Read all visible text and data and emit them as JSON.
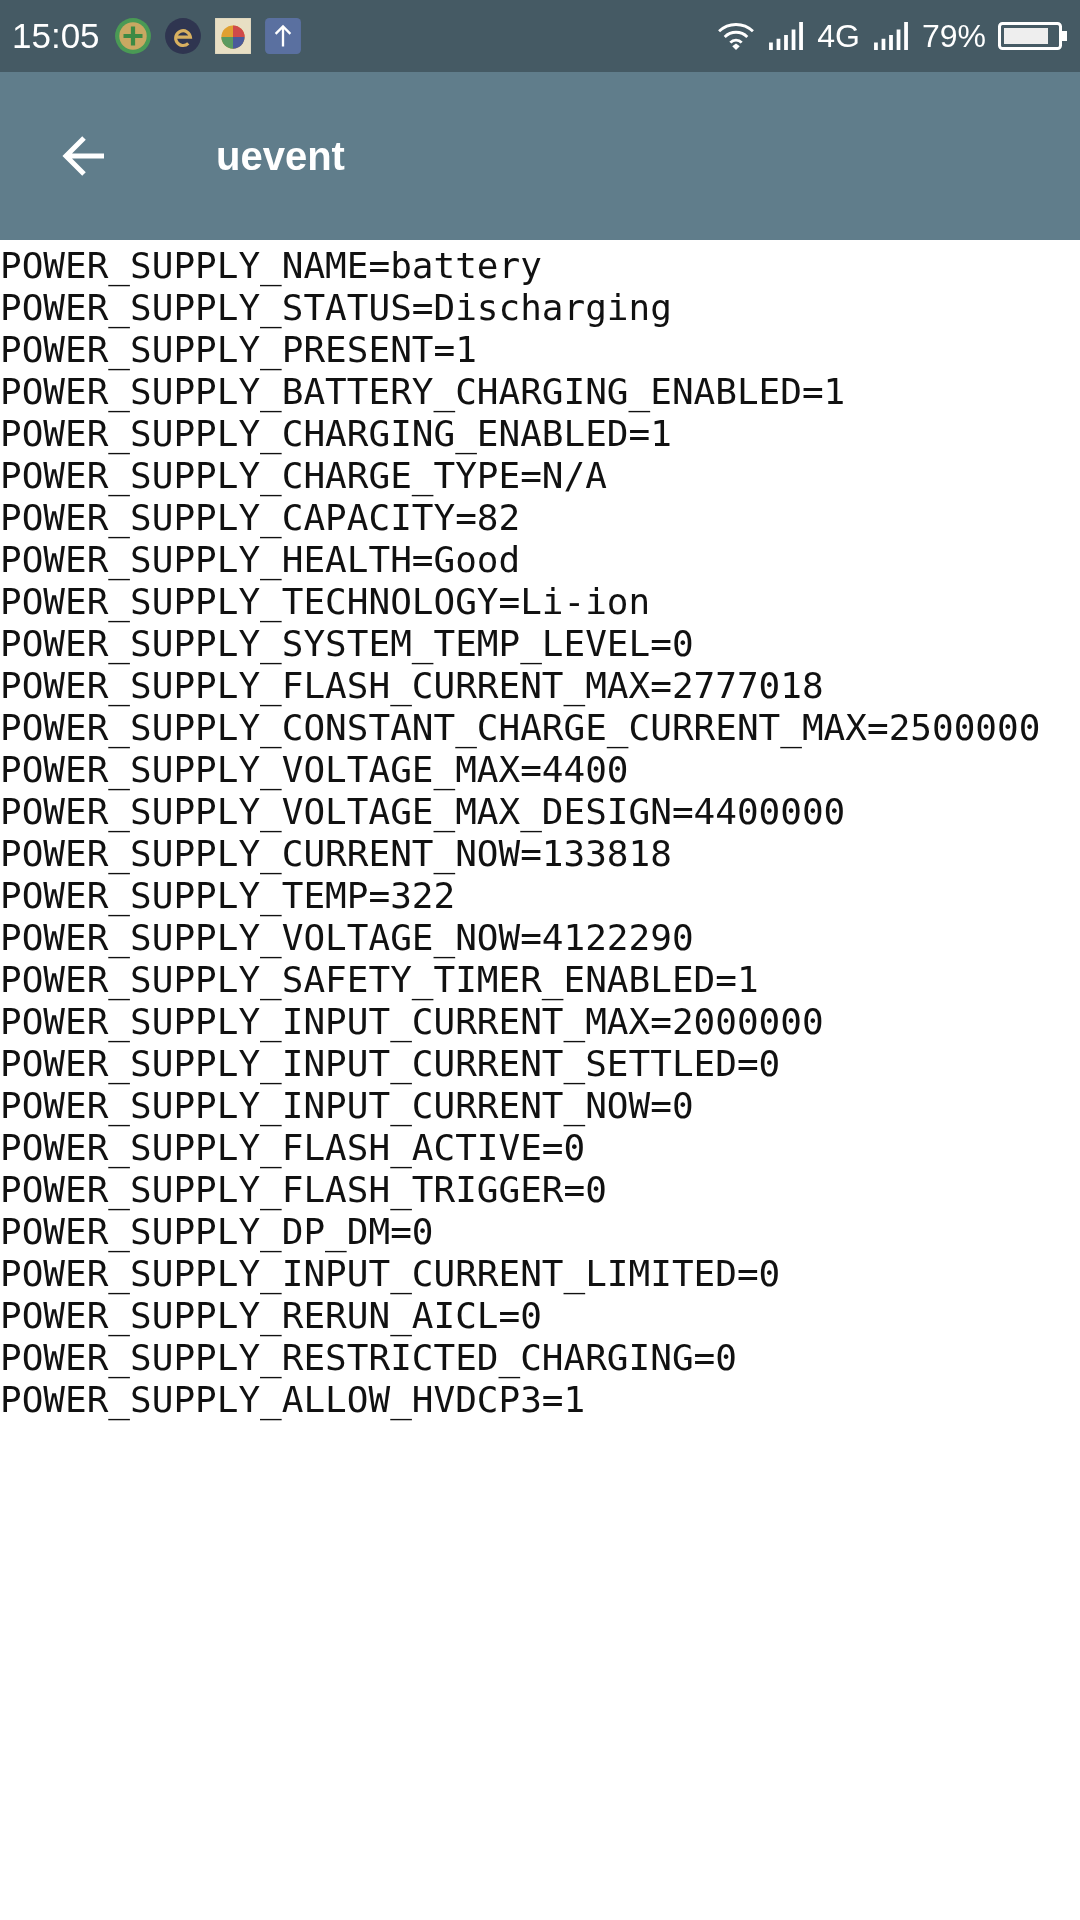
{
  "status_bar": {
    "time": "15:05",
    "network": "4G",
    "battery": "79%"
  },
  "app_bar": {
    "title": "uevent"
  },
  "lines": [
    "POWER_SUPPLY_NAME=battery",
    "POWER_SUPPLY_STATUS=Discharging",
    "POWER_SUPPLY_PRESENT=1",
    "POWER_SUPPLY_BATTERY_CHARGING_ENABLED=1",
    "POWER_SUPPLY_CHARGING_ENABLED=1",
    "POWER_SUPPLY_CHARGE_TYPE=N/A",
    "POWER_SUPPLY_CAPACITY=82",
    "POWER_SUPPLY_HEALTH=Good",
    "POWER_SUPPLY_TECHNOLOGY=Li-ion",
    "POWER_SUPPLY_SYSTEM_TEMP_LEVEL=0",
    "POWER_SUPPLY_FLASH_CURRENT_MAX=2777018",
    "POWER_SUPPLY_CONSTANT_CHARGE_CURRENT_MAX=2500000",
    "POWER_SUPPLY_VOLTAGE_MAX=4400",
    "POWER_SUPPLY_VOLTAGE_MAX_DESIGN=4400000",
    "POWER_SUPPLY_CURRENT_NOW=133818",
    "POWER_SUPPLY_TEMP=322",
    "POWER_SUPPLY_VOLTAGE_NOW=4122290",
    "POWER_SUPPLY_SAFETY_TIMER_ENABLED=1",
    "POWER_SUPPLY_INPUT_CURRENT_MAX=2000000",
    "POWER_SUPPLY_INPUT_CURRENT_SETTLED=0",
    "POWER_SUPPLY_INPUT_CURRENT_NOW=0",
    "POWER_SUPPLY_FLASH_ACTIVE=0",
    "POWER_SUPPLY_FLASH_TRIGGER=0",
    "POWER_SUPPLY_DP_DM=0",
    "POWER_SUPPLY_INPUT_CURRENT_LIMITED=0",
    "POWER_SUPPLY_RERUN_AICL=0",
    "POWER_SUPPLY_RESTRICTED_CHARGING=0",
    "POWER_SUPPLY_ALLOW_HVDCP3=1"
  ]
}
